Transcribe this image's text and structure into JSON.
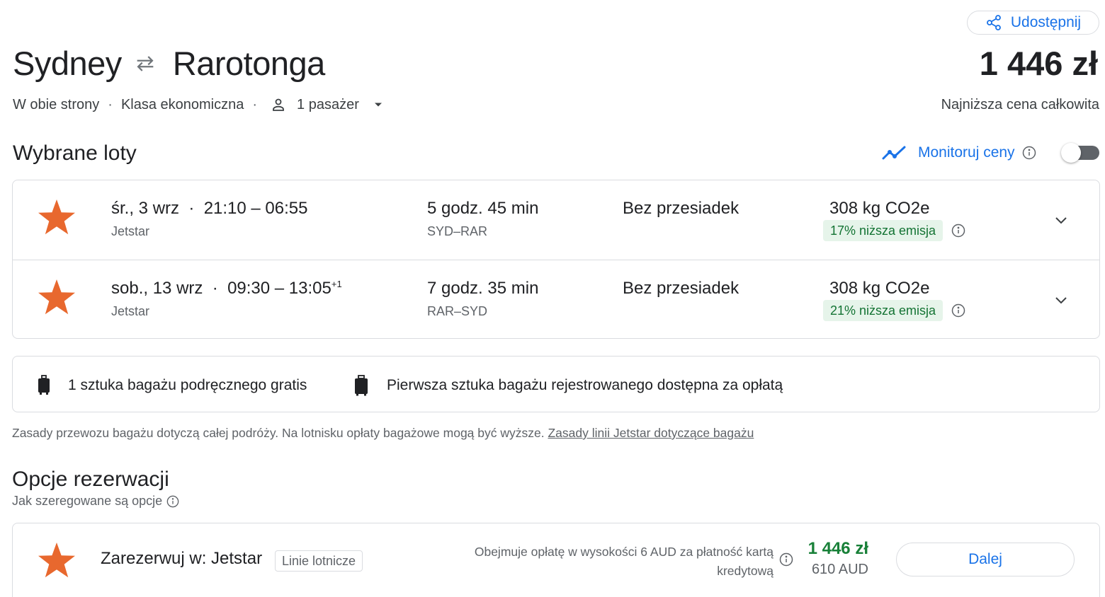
{
  "share": {
    "label": "Udostępnij"
  },
  "route": {
    "origin": "Sydney",
    "destination": "Rarotonga"
  },
  "price": {
    "total": "1 446 zł",
    "caption": "Najniższa cena całkowita"
  },
  "trip": {
    "type": "W obie strony",
    "class": "Klasa ekonomiczna",
    "passengers": "1 pasażer"
  },
  "selected": {
    "title": "Wybrane loty",
    "monitor_label": "Monitoruj ceny",
    "monitor_on": false
  },
  "flights": [
    {
      "date": "śr., 3 wrz",
      "times": "21:10 – 06:55",
      "day_offset": "",
      "airline": "Jetstar",
      "duration": "5 godz. 45 min",
      "airports": "SYD–RAR",
      "stops": "Bez przesiadek",
      "co2": "308 kg CO2e",
      "emission": "17% niższa emisja"
    },
    {
      "date": "sob., 13 wrz",
      "times": "09:30 – 13:05",
      "day_offset": "+1",
      "airline": "Jetstar",
      "duration": "7 godz. 35 min",
      "airports": "RAR–SYD",
      "stops": "Bez przesiadek",
      "co2": "308 kg CO2e",
      "emission": "21% niższa emisja"
    }
  ],
  "baggage": {
    "carry_on": "1 sztuka bagażu podręcznego gratis",
    "checked": "Pierwsza sztuka bagażu rejestrowanego dostępna za opłatą",
    "note": "Zasady przewozu bagażu dotyczą całej podróży. Na lotnisku opłaty bagażowe mogą być wyższe.",
    "link": "Zasady linii Jetstar dotyczące bagażu"
  },
  "booking": {
    "title": "Opcje rezerwacji",
    "sort_info": "Jak szeregowane są opcje",
    "option": {
      "name": "Zarezerwuj w: Jetstar",
      "chip": "Linie lotnicze",
      "fee_line1": "Obejmuje opłatę w wysokości 6 AUD za płatność kartą",
      "fee_line2": "kredytową",
      "price": "1 446 zł",
      "price_aud": "610 AUD",
      "button": "Dalej"
    }
  },
  "colors": {
    "accent": "#1a73e8",
    "jetstar": "#e8682e",
    "green": "#188038",
    "badge_bg": "#e6f4ea"
  }
}
